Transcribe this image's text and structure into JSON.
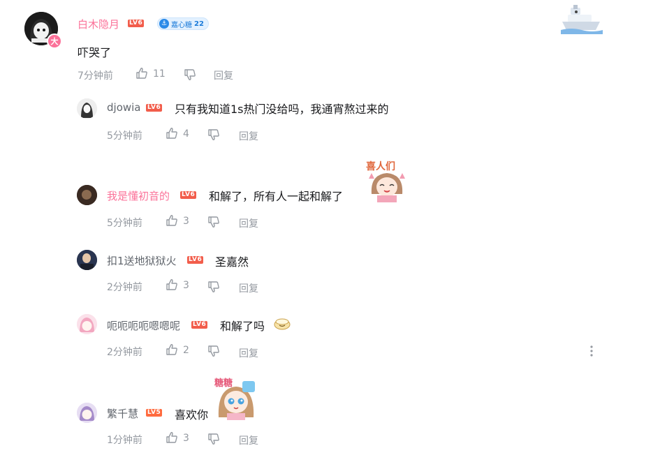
{
  "main_comment": {
    "username": "白木隐月",
    "level": "LV6",
    "medal_label": "嘉心糖",
    "medal_level": "22",
    "vip_label": "大",
    "text": "吓哭了",
    "time": "7分钟前",
    "likes": "11",
    "reply_label": "回复"
  },
  "replies": [
    {
      "username": "djowia",
      "level": "LV6",
      "text": "只有我知道1s热门没给吗，我通宵熬过来的",
      "time": "5分钟前",
      "likes": "4",
      "reply_label": "回复"
    },
    {
      "username": "我是懂初音的",
      "level": "LV6",
      "text": "和解了，所有人一起和解了",
      "sticker_caption": "喜人们",
      "time": "5分钟前",
      "likes": "3",
      "reply_label": "回复"
    },
    {
      "username": "扣1送地狱狱火",
      "level": "LV6",
      "text": "圣嘉然",
      "time": "2分钟前",
      "likes": "3",
      "reply_label": "回复"
    },
    {
      "username": "呃呃呃呃嗯嗯呢",
      "level": "LV6",
      "text": "和解了吗",
      "time": "2分钟前",
      "likes": "2",
      "reply_label": "回复"
    },
    {
      "username": "繁千慧",
      "level": "LV5",
      "text": "喜欢你",
      "sticker_caption": "糖糖",
      "time": "1分钟前",
      "likes": "3",
      "reply_label": "回复"
    }
  ],
  "colors": {
    "accent_pink": "#fb7299",
    "meta_gray": "#9499a0",
    "level_badge": "#f25d4b",
    "medal_blue": "#2a8ae8"
  },
  "icons": [
    "like-icon",
    "dislike-icon",
    "more-icon",
    "avatar-image",
    "sticker-image",
    "emoji-icon"
  ]
}
